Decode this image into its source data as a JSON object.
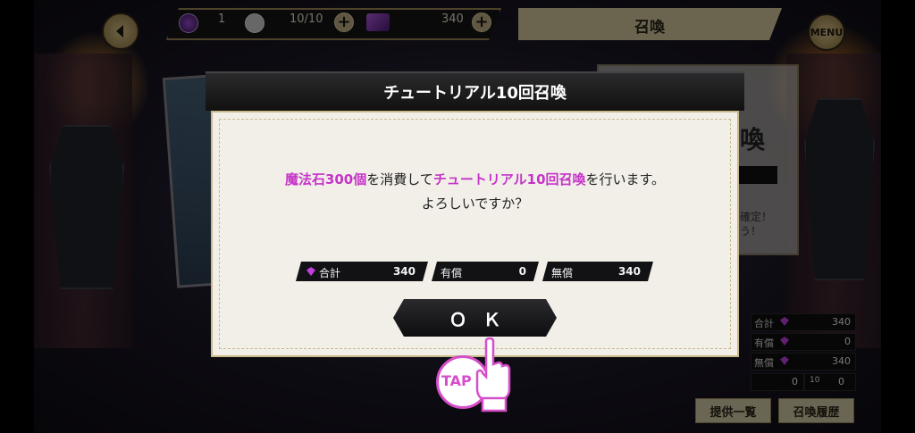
{
  "resources": {
    "ticket_count": "1",
    "stamina": "10/10",
    "gems": "340"
  },
  "header": {
    "title": "召喚",
    "menu_label": "MENU"
  },
  "background_panel": {
    "title_char": "喚",
    "line1": "確定！",
    "line2": "う！"
  },
  "modal": {
    "title": "チュートリアル10回召喚",
    "message": {
      "part1": "魔法石300個",
      "part2": "を消費して",
      "part3": "チュートリアル10回召喚",
      "part4": "を行います。",
      "line2": "よろしいですか？"
    },
    "stats": [
      {
        "label": "合計",
        "value": "340"
      },
      {
        "label": "有償",
        "value": "0"
      },
      {
        "label": "無償",
        "value": "340"
      }
    ],
    "ok_label": "ＯＫ"
  },
  "tap_label": "TAP",
  "right_panel": {
    "rows": [
      {
        "label": "合計",
        "value": "340"
      },
      {
        "label": "有償",
        "value": "0"
      },
      {
        "label": "無償",
        "value": "340"
      }
    ],
    "extra": [
      {
        "value": "0"
      },
      {
        "badge": "10",
        "value": "0"
      }
    ]
  },
  "footer": {
    "offer_list": "提供一覧",
    "history": "召喚履歴"
  },
  "colors": {
    "highlight": "#c534c8",
    "gold": "#d6c99f",
    "gem": "#c040e0"
  }
}
